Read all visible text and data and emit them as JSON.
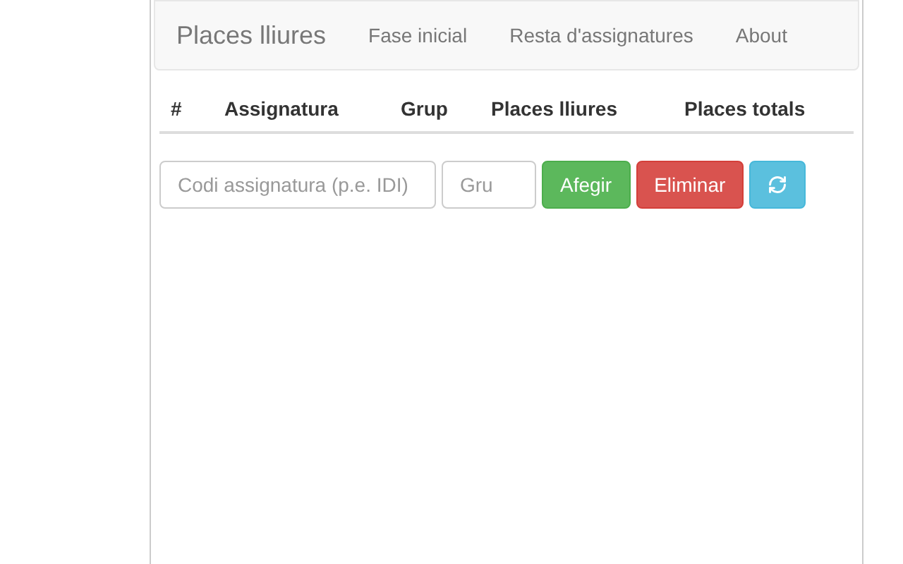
{
  "navbar": {
    "brand": "Places lliures",
    "links": [
      {
        "label": "Fase inicial"
      },
      {
        "label": "Resta d'assignatures"
      },
      {
        "label": "About"
      }
    ]
  },
  "table": {
    "columns": [
      "#",
      "Assignatura",
      "Grup",
      "Places lliures",
      "Places totals"
    ]
  },
  "form": {
    "subject": {
      "placeholder": "Codi assignatura (p.e. IDI)"
    },
    "group": {
      "placeholder": "Gru"
    },
    "buttons": [
      {
        "label": "Afegir",
        "kind": "add"
      },
      {
        "label": "Eliminar",
        "kind": "remove"
      },
      {
        "kind": "refresh"
      }
    ]
  }
}
